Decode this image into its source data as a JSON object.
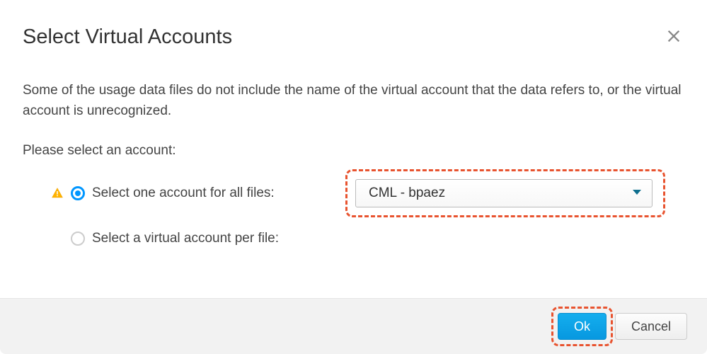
{
  "dialog": {
    "title": "Select Virtual Accounts",
    "description": "Some of the usage data files do not include the name of the virtual account that the data refers to, or the virtual account is unrecognized.",
    "prompt": "Please select an account:",
    "options": {
      "all_files": {
        "label": "Select one account for all files:",
        "selected": true,
        "has_warning": true
      },
      "per_file": {
        "label": "Select a virtual account per file:",
        "selected": false,
        "has_warning": false
      }
    },
    "dropdown": {
      "selected_value": "CML - bpaez"
    },
    "buttons": {
      "ok": "Ok",
      "cancel": "Cancel"
    }
  }
}
